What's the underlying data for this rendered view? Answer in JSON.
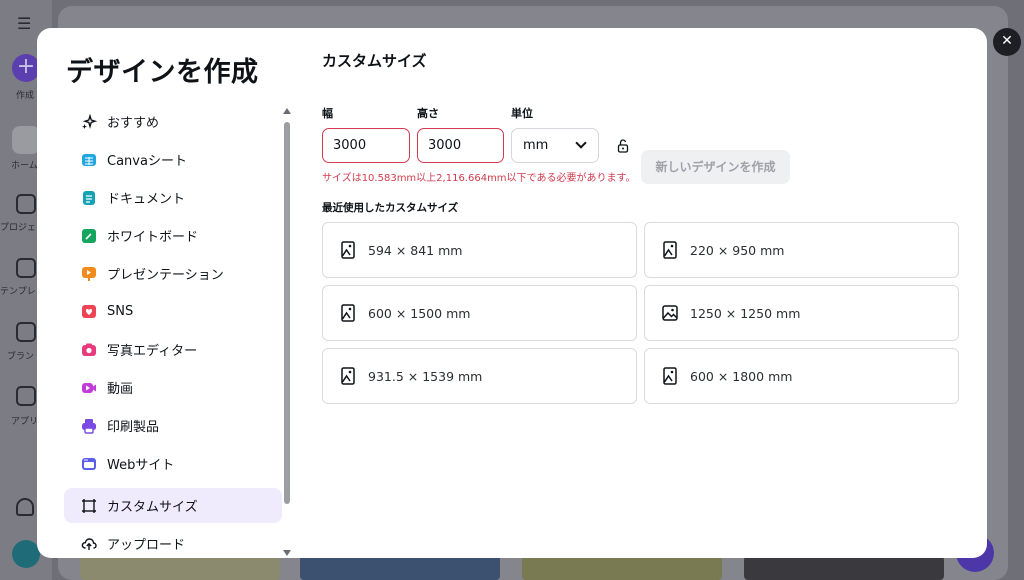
{
  "background": {
    "create_label": "作成",
    "nav_labels": [
      "ホーム",
      "プロジェ",
      "テンプレ",
      "ブラン",
      "アプリ"
    ]
  },
  "dialog": {
    "title": "デザインを作成",
    "close_icon": "close-icon",
    "categories": [
      {
        "label": "おすすめ",
        "icon": "sparkle-icon",
        "color": "#0e1318"
      },
      {
        "label": "Canvaシート",
        "icon": "sheet-icon",
        "color": "#21a7e0"
      },
      {
        "label": "ドキュメント",
        "icon": "document-icon",
        "color": "#13a3b5"
      },
      {
        "label": "ホワイトボード",
        "icon": "whiteboard-icon",
        "color": "#16a45f"
      },
      {
        "label": "プレゼンテーション",
        "icon": "presentation-icon",
        "color": "#f28b1e"
      },
      {
        "label": "SNS",
        "icon": "heart-icon",
        "color": "#ef4455"
      },
      {
        "label": "写真エディター",
        "icon": "camera-icon",
        "color": "#e93a7d"
      },
      {
        "label": "動画",
        "icon": "video-icon",
        "color": "#c13cd6"
      },
      {
        "label": "印刷製品",
        "icon": "printer-icon",
        "color": "#7a4be3"
      },
      {
        "label": "Webサイト",
        "icon": "website-icon",
        "color": "#5b5fe8"
      },
      {
        "label": "カスタムサイズ",
        "icon": "custom-size-icon",
        "color": "#0e1318",
        "active": true
      },
      {
        "label": "アップロード",
        "icon": "upload-icon",
        "color": "#0e1318"
      }
    ]
  },
  "custom": {
    "title": "カスタムサイズ",
    "width_label": "幅",
    "width_value": "3000",
    "height_label": "高さ",
    "height_value": "3000",
    "unit_label": "単位",
    "unit_value": "mm",
    "error": "サイズは10.583mm以上2,116.664mm以下である必要があります。",
    "create_button": "新しいデザインを作成",
    "recent_title": "最近使用したカスタムサイズ",
    "recent": [
      {
        "label": "594 × 841 mm",
        "icon": "portrait-image-icon"
      },
      {
        "label": "220 × 950 mm",
        "icon": "portrait-image-icon"
      },
      {
        "label": "600 × 1500 mm",
        "icon": "portrait-image-icon"
      },
      {
        "label": "1250 × 1250 mm",
        "icon": "square-image-icon"
      },
      {
        "label": "931.5 × 1539 mm",
        "icon": "portrait-image-icon"
      },
      {
        "label": "600 × 1800 mm",
        "icon": "portrait-image-icon"
      }
    ]
  },
  "colors": {
    "error": "#d13b4d",
    "active_bg": "#efeafc",
    "brand_purple": "#7d2ae8"
  }
}
